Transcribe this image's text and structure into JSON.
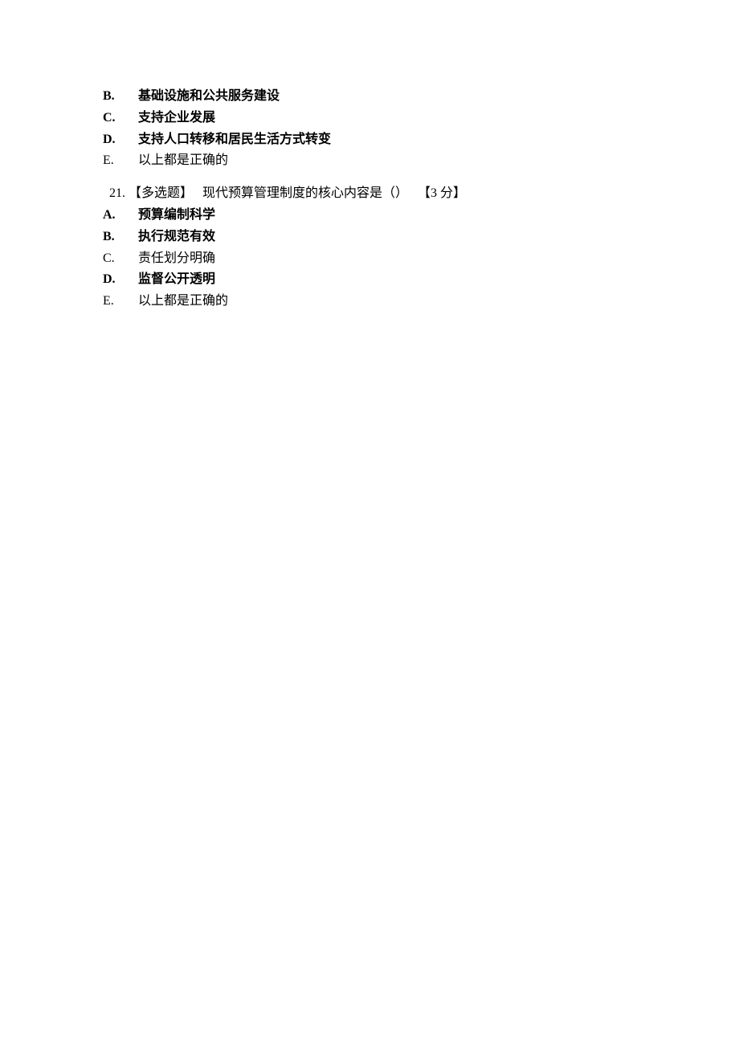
{
  "q20": {
    "options": [
      {
        "letter": "B.",
        "text": "基础设施和公共服务建设",
        "bold": true
      },
      {
        "letter": "C.",
        "text": "支持企业发展",
        "bold": true
      },
      {
        "letter": "D.",
        "text": "支持人口转移和居民生活方式转变",
        "bold": true
      },
      {
        "letter": "E.",
        "text": "以上都是正确的",
        "bold": false
      }
    ]
  },
  "q21": {
    "number": "21.",
    "tag": "【多选题】",
    "stem": "现代预算管理制度的核心内容是（）",
    "points_prefix": "【",
    "points_num": "3",
    "points_suffix": " 分】",
    "options": [
      {
        "letter": "A.",
        "text": "预算编制科学",
        "bold": true
      },
      {
        "letter": "B.",
        "text": "执行规范有效",
        "bold": true
      },
      {
        "letter": "C.",
        "text": "责任划分明确",
        "bold": false
      },
      {
        "letter": "D.",
        "text": "监督公开透明",
        "bold": true
      },
      {
        "letter": "E.",
        "text": "以上都是正确的",
        "bold": false
      }
    ]
  }
}
